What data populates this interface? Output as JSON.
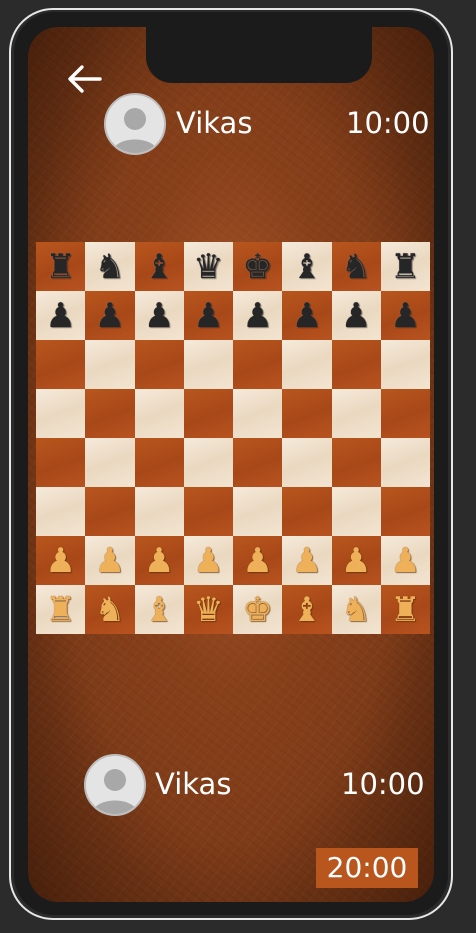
{
  "top_player": {
    "name": "Vikas",
    "clock": "10:00"
  },
  "bottom_player": {
    "name": "Vikas",
    "clock": "10:00"
  },
  "game_timer": "20:00",
  "colors": {
    "dark_square": "#a84818",
    "light_square": "#f3e5d2",
    "timer_bg": "#b9561e"
  },
  "board": [
    [
      "bR",
      "bN",
      "bB",
      "bQ",
      "bK",
      "bB",
      "bN",
      "bR"
    ],
    [
      "bP",
      "bP",
      "bP",
      "bP",
      "bP",
      "bP",
      "bP",
      "bP"
    ],
    [
      "",
      "",
      "",
      "",
      "",
      "",
      "",
      ""
    ],
    [
      "",
      "",
      "",
      "",
      "",
      "",
      "",
      ""
    ],
    [
      "",
      "",
      "",
      "",
      "",
      "",
      "",
      ""
    ],
    [
      "",
      "",
      "",
      "",
      "",
      "",
      "",
      ""
    ],
    [
      "wP",
      "wP",
      "wP",
      "wP",
      "wP",
      "wP",
      "wP",
      "wP"
    ],
    [
      "wR",
      "wN",
      "wB",
      "wQ",
      "wK",
      "wB",
      "wN",
      "wR"
    ]
  ]
}
